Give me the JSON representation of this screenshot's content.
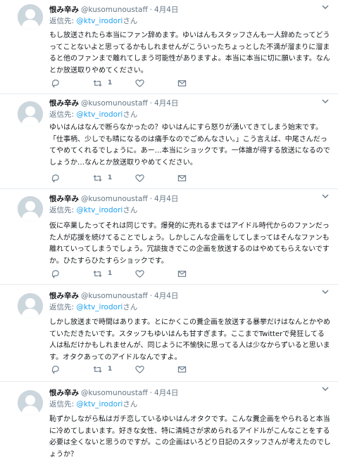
{
  "tweets": [
    {
      "name": "恨み辛み",
      "handle": "@kusomunoustaff",
      "dot": "·",
      "time": "4月4日",
      "reply_prefix": "返信先: ",
      "reply_mention": "@ktv_irodori",
      "reply_suffix": "さん",
      "text": "もし放送されたら本当にファン辞めます。ゆいはんもスタッフさんも一人辞めたってどうってことないよと思ってるかもしれませんがこういったちょっとした不満が溜まりに溜まると他のファンまで離れてしまう可能性がありますよ。本当に本当に切に願います。なんとか放送取りやめてください。",
      "retweet_count": "1"
    },
    {
      "name": "恨み辛み",
      "handle": "@kusomunoustaff",
      "dot": "·",
      "time": "4月4日",
      "reply_prefix": "返信先: ",
      "reply_mention": "@ktv_irodori",
      "reply_suffix": "さん",
      "text": "ゆいはんはなんで断らなかったの？ゆいはんにすら怒りが湧いてきてしまう始末です。「仕事柄、少しでも晴になるのは痛手なのでごめんなさい。」こう言えば、中尾さんだってやめてくれるでしょうに。あー…本当にショックです。一体誰が得する放送になるのでしょうか…なんとか放送取りやめてください。",
      "retweet_count": "1"
    },
    {
      "name": "恨み辛み",
      "handle": "@kusomunoustaff",
      "dot": "·",
      "time": "4月4日",
      "reply_prefix": "返信先: ",
      "reply_mention": "@ktv_irodori",
      "reply_suffix": "さん",
      "text": "仮に卒業したってそれは同じです。爆発的に売れるまではアイドル時代からのファンだった人が応援を続けてることでしょう。しかしこんな企画をしてしまってはそんなファンも離れていってしまうでしょう。冗談抜きでこの企画を放送するのはやめてもらえないですか。ひたすらひたすらショックです。",
      "retweet_count": "1"
    },
    {
      "name": "恨み辛み",
      "handle": "@kusomunoustaff",
      "dot": "·",
      "time": "4月4日",
      "reply_prefix": "返信先: ",
      "reply_mention": "@ktv_irodori",
      "reply_suffix": "さん",
      "text": "しかし放送まで時間はあります。とにかくこの糞企画を放送する暴挙だけはなんとかやめていただきたいです。スタッフもゆいはんも甘すぎます。ここまでTwitterで発狂してる人は私だけかもしれませんが、同じように不愉快に思ってる人は少なからずいると思います。オタクあってのアイドルなんですよ。",
      "retweet_count": "1"
    },
    {
      "name": "恨み辛み",
      "handle": "@kusomunoustaff",
      "dot": "·",
      "time": "4月4日",
      "reply_prefix": "返信先: ",
      "reply_mention": "@ktv_irodori",
      "reply_suffix": "さん",
      "text": "恥ずかしながら私はガチ恋しているゆいはんオタクです。こんな糞企画をやられると本当に冷めてしまいます。好きな女性、特に清純さが求められるアイドルがこんなことをする必要は全くないと思うのですが。この企画はいろどり日記のスタッフさんが考えたのでしょうか？",
      "retweet_count": ""
    }
  ],
  "icons": {
    "avatar": "default-profile-icon",
    "caret": "chevron-down-icon",
    "reply": "reply-icon",
    "retweet": "retweet-icon",
    "like": "heart-icon",
    "dm": "envelope-icon"
  },
  "colors": {
    "link": "#1da1f2",
    "secondary_text": "#657786",
    "divider": "#e6ecf0"
  }
}
